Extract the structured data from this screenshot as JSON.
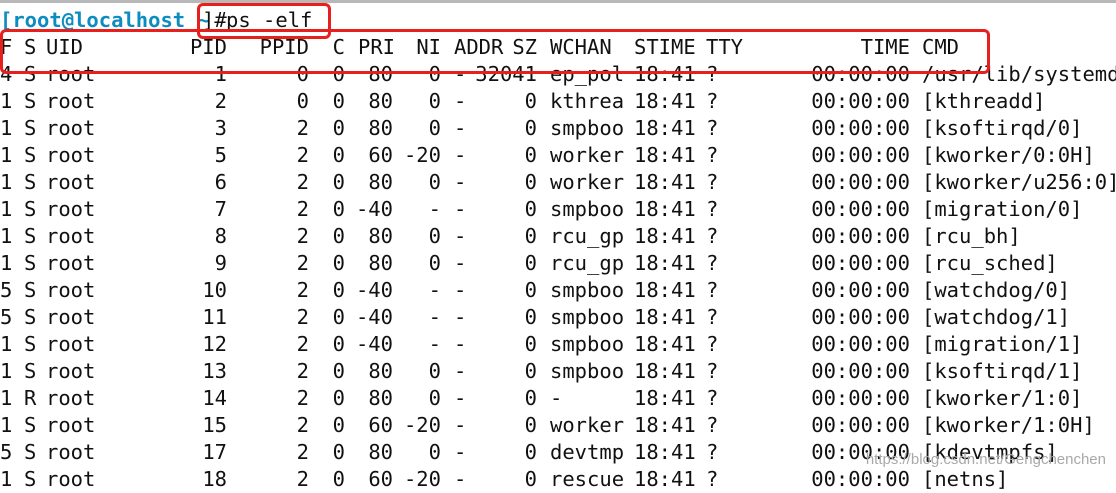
{
  "command": {
    "prompt": "[root@localhost ~]#",
    "user_part": "[root@localhost ~",
    "rest_part": "]#",
    "text": "ps -elf"
  },
  "columns": [
    "F",
    "S",
    "UID",
    "PID",
    "PPID",
    "C",
    "PRI",
    "NI",
    "ADDR",
    "SZ",
    "WCHAN",
    "STIME",
    "TTY",
    "TIME",
    "CMD"
  ],
  "rows": [
    {
      "F": "4",
      "S": "S",
      "UID": "root",
      "PID": "1",
      "PPID": "0",
      "C": "0",
      "PRI": "80",
      "NI": "0",
      "ADDR": "-",
      "SZ": "32041",
      "WCHAN": "ep_pol",
      "STIME": "18:41",
      "TTY": "?",
      "TIME": "00:00:00",
      "CMD": "/usr/lib/systemd"
    },
    {
      "F": "1",
      "S": "S",
      "UID": "root",
      "PID": "2",
      "PPID": "0",
      "C": "0",
      "PRI": "80",
      "NI": "0",
      "ADDR": "-",
      "SZ": "0",
      "WCHAN": "kthrea",
      "STIME": "18:41",
      "TTY": "?",
      "TIME": "00:00:00",
      "CMD": "[kthreadd]"
    },
    {
      "F": "1",
      "S": "S",
      "UID": "root",
      "PID": "3",
      "PPID": "2",
      "C": "0",
      "PRI": "80",
      "NI": "0",
      "ADDR": "-",
      "SZ": "0",
      "WCHAN": "smpboo",
      "STIME": "18:41",
      "TTY": "?",
      "TIME": "00:00:00",
      "CMD": "[ksoftirqd/0]"
    },
    {
      "F": "1",
      "S": "S",
      "UID": "root",
      "PID": "5",
      "PPID": "2",
      "C": "0",
      "PRI": "60",
      "NI": "-20",
      "ADDR": "-",
      "SZ": "0",
      "WCHAN": "worker",
      "STIME": "18:41",
      "TTY": "?",
      "TIME": "00:00:00",
      "CMD": "[kworker/0:0H]"
    },
    {
      "F": "1",
      "S": "S",
      "UID": "root",
      "PID": "6",
      "PPID": "2",
      "C": "0",
      "PRI": "80",
      "NI": "0",
      "ADDR": "-",
      "SZ": "0",
      "WCHAN": "worker",
      "STIME": "18:41",
      "TTY": "?",
      "TIME": "00:00:00",
      "CMD": "[kworker/u256:0]"
    },
    {
      "F": "1",
      "S": "S",
      "UID": "root",
      "PID": "7",
      "PPID": "2",
      "C": "0",
      "PRI": "-40",
      "NI": "-",
      "ADDR": "-",
      "SZ": "0",
      "WCHAN": "smpboo",
      "STIME": "18:41",
      "TTY": "?",
      "TIME": "00:00:00",
      "CMD": "[migration/0]"
    },
    {
      "F": "1",
      "S": "S",
      "UID": "root",
      "PID": "8",
      "PPID": "2",
      "C": "0",
      "PRI": "80",
      "NI": "0",
      "ADDR": "-",
      "SZ": "0",
      "WCHAN": "rcu_gp",
      "STIME": "18:41",
      "TTY": "?",
      "TIME": "00:00:00",
      "CMD": "[rcu_bh]"
    },
    {
      "F": "1",
      "S": "S",
      "UID": "root",
      "PID": "9",
      "PPID": "2",
      "C": "0",
      "PRI": "80",
      "NI": "0",
      "ADDR": "-",
      "SZ": "0",
      "WCHAN": "rcu_gp",
      "STIME": "18:41",
      "TTY": "?",
      "TIME": "00:00:00",
      "CMD": "[rcu_sched]"
    },
    {
      "F": "5",
      "S": "S",
      "UID": "root",
      "PID": "10",
      "PPID": "2",
      "C": "0",
      "PRI": "-40",
      "NI": "-",
      "ADDR": "-",
      "SZ": "0",
      "WCHAN": "smpboo",
      "STIME": "18:41",
      "TTY": "?",
      "TIME": "00:00:00",
      "CMD": "[watchdog/0]"
    },
    {
      "F": "5",
      "S": "S",
      "UID": "root",
      "PID": "11",
      "PPID": "2",
      "C": "0",
      "PRI": "-40",
      "NI": "-",
      "ADDR": "-",
      "SZ": "0",
      "WCHAN": "smpboo",
      "STIME": "18:41",
      "TTY": "?",
      "TIME": "00:00:00",
      "CMD": "[watchdog/1]"
    },
    {
      "F": "1",
      "S": "S",
      "UID": "root",
      "PID": "12",
      "PPID": "2",
      "C": "0",
      "PRI": "-40",
      "NI": "-",
      "ADDR": "-",
      "SZ": "0",
      "WCHAN": "smpboo",
      "STIME": "18:41",
      "TTY": "?",
      "TIME": "00:00:00",
      "CMD": "[migration/1]"
    },
    {
      "F": "1",
      "S": "S",
      "UID": "root",
      "PID": "13",
      "PPID": "2",
      "C": "0",
      "PRI": "80",
      "NI": "0",
      "ADDR": "-",
      "SZ": "0",
      "WCHAN": "smpboo",
      "STIME": "18:41",
      "TTY": "?",
      "TIME": "00:00:00",
      "CMD": "[ksoftirqd/1]"
    },
    {
      "F": "1",
      "S": "R",
      "UID": "root",
      "PID": "14",
      "PPID": "2",
      "C": "0",
      "PRI": "80",
      "NI": "0",
      "ADDR": "-",
      "SZ": "0",
      "WCHAN": "-",
      "STIME": "18:41",
      "TTY": "?",
      "TIME": "00:00:00",
      "CMD": "[kworker/1:0]"
    },
    {
      "F": "1",
      "S": "S",
      "UID": "root",
      "PID": "15",
      "PPID": "2",
      "C": "0",
      "PRI": "60",
      "NI": "-20",
      "ADDR": "-",
      "SZ": "0",
      "WCHAN": "worker",
      "STIME": "18:41",
      "TTY": "?",
      "TIME": "00:00:00",
      "CMD": "[kworker/1:0H]"
    },
    {
      "F": "5",
      "S": "S",
      "UID": "root",
      "PID": "17",
      "PPID": "2",
      "C": "0",
      "PRI": "80",
      "NI": "0",
      "ADDR": "-",
      "SZ": "0",
      "WCHAN": "devtmp",
      "STIME": "18:41",
      "TTY": "?",
      "TIME": "00:00:00",
      "CMD": "[kdevtmpfs]"
    },
    {
      "F": "1",
      "S": "S",
      "UID": "root",
      "PID": "18",
      "PPID": "2",
      "C": "0",
      "PRI": "60",
      "NI": "-20",
      "ADDR": "-",
      "SZ": "0",
      "WCHAN": "rescue",
      "STIME": "18:41",
      "TTY": "?",
      "TIME": "00:00:00",
      "CMD": "[netns]"
    }
  ],
  "watermark": "https://blog.csdn.net/Gengchenchen",
  "colors": {
    "highlight": "#e8201d",
    "prompt": "#0d8dbf",
    "text": "#111111",
    "background": "#ffffff"
  }
}
